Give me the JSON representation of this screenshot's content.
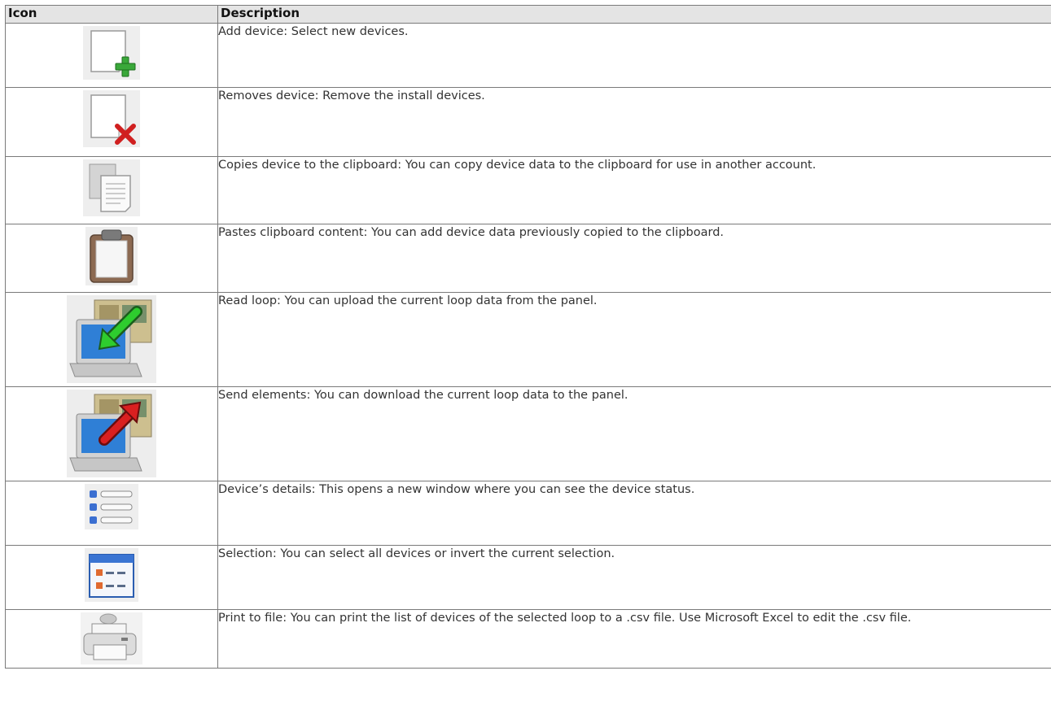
{
  "table": {
    "headers": {
      "icon": "Icon",
      "description": "Description"
    },
    "rows": [
      {
        "icon": "add-device-icon",
        "description": "Add device: Select new devices."
      },
      {
        "icon": "remove-device-icon",
        "description": "Removes device: Remove the install devices."
      },
      {
        "icon": "copy-icon",
        "description": "Copies device to the clipboard: You can copy device data to the clipboard for use in another account."
      },
      {
        "icon": "paste-clipboard-icon",
        "description": "Pastes clipboard content: You can add device data previously copied to the clipboard."
      },
      {
        "icon": "read-loop-icon",
        "description": "Read loop: You can upload the current loop data from the panel."
      },
      {
        "icon": "send-elements-icon",
        "description": "Send elements: You can download the current loop data to the panel."
      },
      {
        "icon": "device-details-icon",
        "description": "Device’s details: This opens a new window where you can see the device status."
      },
      {
        "icon": "selection-icon",
        "description": "Selection: You can select all devices or invert the current selection."
      },
      {
        "icon": "print-to-file-icon",
        "description": "Print to file: You can print the list of devices of the selected loop to a .csv file. Use Microsoft Excel to edit the .csv file."
      }
    ]
  }
}
